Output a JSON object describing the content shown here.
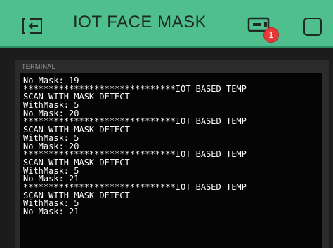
{
  "header": {
    "title": "IOT FACE MASK",
    "device_badge": "1",
    "accent_color": "#4fbf8d",
    "icons": {
      "back": "back-arrow-box-icon",
      "device": "device-icon",
      "square": "square-outline-icon"
    }
  },
  "terminal": {
    "label": "TERMINAL",
    "lines": [
      "No Mask: 19",
      "******************************IOT BASED TEMP",
      "SCAN WITH MASK DETECT",
      "WithMask: 5",
      "No Mask: 20",
      "******************************IOT BASED TEMP",
      "SCAN WITH MASK DETECT",
      "WithMask: 5",
      "No Mask: 20",
      "******************************IOT BASED TEMP",
      "SCAN WITH MASK DETECT",
      "WithMask: 5",
      "No Mask: 21",
      "******************************IOT BASED TEMP",
      "SCAN WITH MASK DETECT",
      "WithMask: 5",
      "No Mask: 21"
    ]
  }
}
